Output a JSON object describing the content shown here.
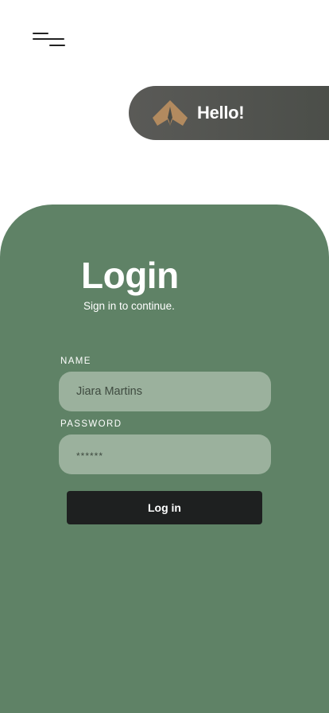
{
  "header": {
    "menu_icon": "hamburger-menu-icon",
    "greeting": {
      "logo_icon": "rocket-arrow-logo-icon",
      "text": "Hello!"
    }
  },
  "login": {
    "title": "Login",
    "subtitle": "Sign in to continue.",
    "name_field": {
      "label": "NAME",
      "value": "Jiara Martins"
    },
    "password_field": {
      "label": "PASSWORD",
      "value": "******"
    },
    "submit_label": "Log in"
  },
  "colors": {
    "card_background": "#5f8266",
    "field_background": "#9bb19d",
    "pill_background": "#555753",
    "logo_accent": "#b28a5f",
    "button_background": "#1e2020"
  }
}
